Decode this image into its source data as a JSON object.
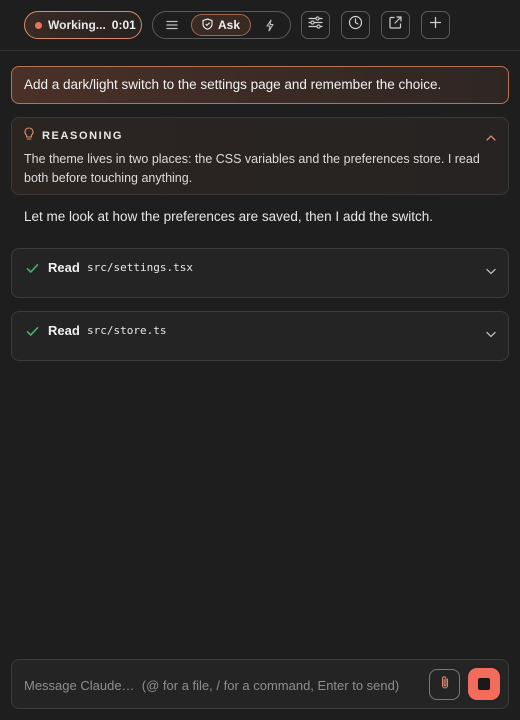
{
  "topbar": {
    "status": {
      "label": "Working...",
      "timer": "0:01"
    },
    "mode": {
      "menu_icon": "menu-icon",
      "ask_label": "Ask",
      "ask_icon": "shield-icon",
      "bolt_icon": "bolt-icon"
    },
    "buttons": [
      {
        "icon": "sliders-icon"
      },
      {
        "icon": "history-icon"
      },
      {
        "icon": "external-link-icon"
      },
      {
        "icon": "plus-icon"
      }
    ]
  },
  "conversation": {
    "user_message": "Add a dark/light switch to the settings page and remember the choice.",
    "reasoning": {
      "title": "REASONING",
      "text": "The theme lives in two places: the CSS variables and the preferences store. I read both before touching anything."
    },
    "assistant_text": "Let me look at how the preferences are saved, then I add the switch.",
    "tool_calls": [
      {
        "verb": "Read",
        "path": "src/settings.tsx",
        "status": "done"
      },
      {
        "verb": "Read",
        "path": "src/store.ts",
        "status": "done"
      }
    ]
  },
  "composer": {
    "placeholder": "Message Claude…  (@ for a file, / for a command, Enter to send)",
    "value": ""
  },
  "colors": {
    "accent": "#d98a6a",
    "status_dot": "#e4765a",
    "success": "#4caf6a",
    "stop": "#f26b5b",
    "background": "#1e1e1e"
  }
}
